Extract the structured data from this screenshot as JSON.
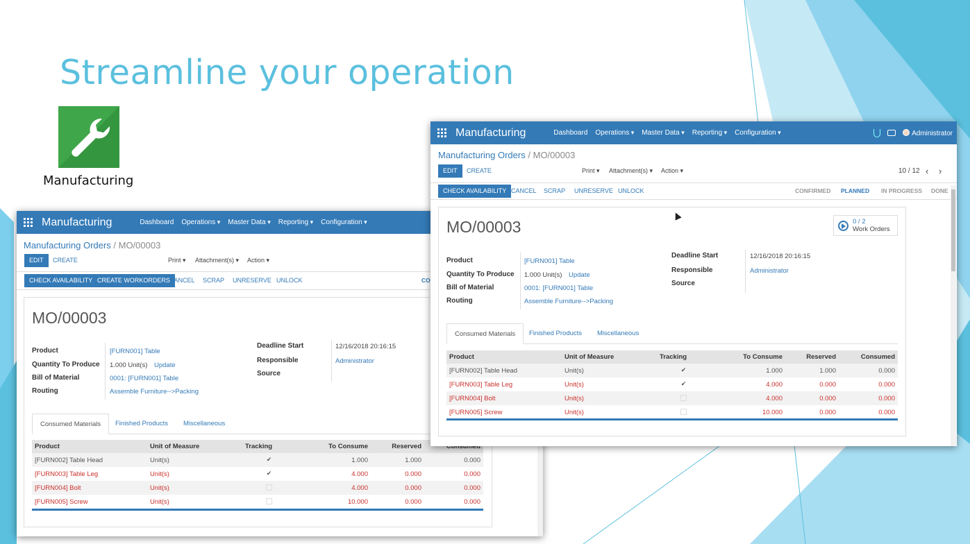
{
  "slide": {
    "title": "Streamline your operation",
    "app_icon_label": "Manufacturing",
    "accent": "#5bc0de",
    "icon_bg": "#3fa74a",
    "icon_name": "wrench-icon"
  },
  "app": {
    "name": "Manufacturing",
    "menu": [
      "Dashboard",
      "Operations",
      "Master Data",
      "Reporting",
      "Configuration"
    ],
    "user": "Administrator",
    "topbar_color": "#337ab7"
  },
  "breadcrumb": {
    "parent": "Manufacturing Orders",
    "separator": "/",
    "current": "MO/00003"
  },
  "buttons": {
    "edit": "EDIT",
    "create": "CREATE",
    "print": "Print",
    "attachments": "Attachment(s)",
    "action": "Action"
  },
  "pager": "10 / 12",
  "back_actions": [
    "CHECK AVAILABILITY",
    "CREATE WORKORDERS",
    "CANCEL",
    "SCRAP",
    "UNRESERVE",
    "UNLOCK"
  ],
  "back_status_partial": "CON",
  "front_actions": [
    "CHECK AVAILABILITY",
    "CANCEL",
    "SCRAP",
    "UNRESERVE",
    "UNLOCK"
  ],
  "statusbar": [
    "CONFIRMED",
    "PLANNED",
    "IN PROGRESS",
    "DONE"
  ],
  "order": {
    "name": "MO/00003",
    "labels": {
      "product": "Product",
      "qty": "Quantity To Produce",
      "bom": "Bill of Material",
      "routing": "Routing",
      "deadline": "Deadline Start",
      "responsible": "Responsible",
      "source": "Source"
    },
    "product": "[FURN001] Table",
    "qty": "1.000 Unit(s)",
    "update": "Update",
    "bom": "0001: [FURN001] Table",
    "routing": "Assemble Furniture-->Packing",
    "deadline": "12/16/2018 20:16:15",
    "responsible": "Administrator",
    "source": ""
  },
  "work_orders": {
    "count": "0 / 2",
    "label": "Work Orders"
  },
  "tabs": [
    "Consumed Materials",
    "Finished Products",
    "Miscellaneous"
  ],
  "table": {
    "headers": [
      "Product",
      "Unit of Measure",
      "Tracking",
      "To Consume",
      "Reserved",
      "Consumed"
    ],
    "rows": [
      {
        "product": "[FURN002] Table Head",
        "uom": "Unit(s)",
        "tracked": true,
        "to_consume": "1.000",
        "reserved": "1.000",
        "consumed": "0.000",
        "warning": false
      },
      {
        "product": "[FURN003] Table Leg",
        "uom": "Unit(s)",
        "tracked": true,
        "to_consume": "4.000",
        "reserved": "0.000",
        "consumed": "0.000",
        "warning": true
      },
      {
        "product": "[FURN004] Bolt",
        "uom": "Unit(s)",
        "tracked": false,
        "to_consume": "4.000",
        "reserved": "0.000",
        "consumed": "0.000",
        "warning": true
      },
      {
        "product": "[FURN005] Screw",
        "uom": "Unit(s)",
        "tracked": false,
        "to_consume": "10.000",
        "reserved": "0.000",
        "consumed": "0.000",
        "warning": true
      }
    ]
  }
}
